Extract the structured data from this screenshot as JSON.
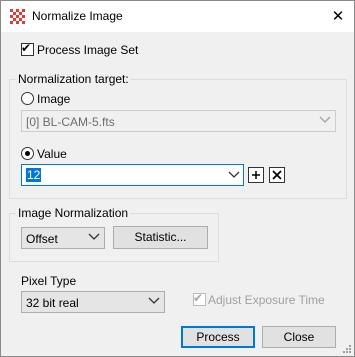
{
  "window": {
    "title": "Normalize Image",
    "close_glyph": "✕",
    "icon": "app-grid-icon"
  },
  "process_image_set": {
    "label": "Process Image Set",
    "checked": true
  },
  "normalization_target": {
    "legend": "Normalization target:",
    "image_radio_label": "Image",
    "image_combo_value": "[0] BL-CAM-5.fts",
    "value_radio_label": "Value",
    "value_input": "12",
    "selected": "Value"
  },
  "image_normalization": {
    "legend": "Image Normalization",
    "method_value": "Offset",
    "statistic_button": "Statistic..."
  },
  "pixel_type": {
    "label": "Pixel Type",
    "value": "32 bit real"
  },
  "adjust_exposure": {
    "label": "Adjust Exposure Time",
    "checked": true,
    "enabled": false
  },
  "buttons": {
    "process": "Process",
    "close": "Close"
  },
  "colors": {
    "accent": "#0078d7",
    "icon_red": "#e53935"
  }
}
